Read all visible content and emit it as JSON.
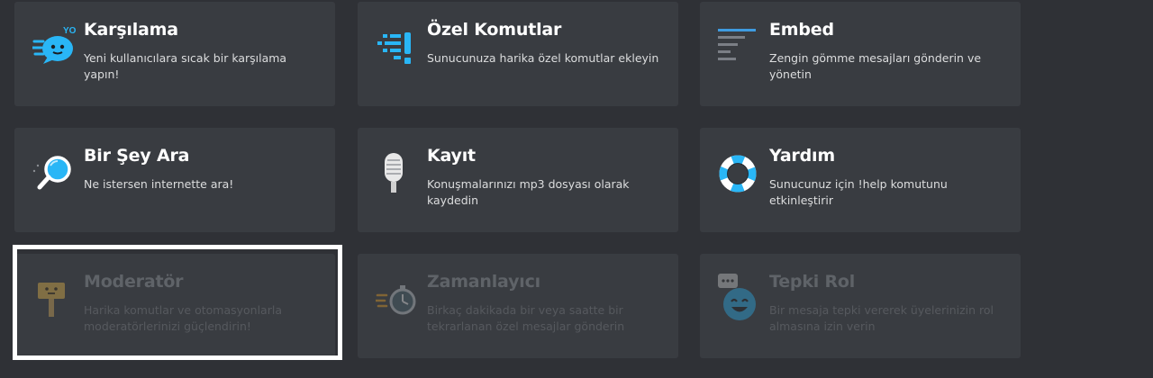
{
  "cards": [
    {
      "title": "Karşılama",
      "desc": "Yeni kullanıcılara sıcak bir karşılama yapın!",
      "icon": "welcome-yo-icon"
    },
    {
      "title": "Özel Komutlar",
      "desc": "Sunucunuza harika özel komutlar ekleyin",
      "icon": "custom-commands-icon"
    },
    {
      "title": "Embed",
      "desc": "Zengin gömme mesajları gönderin ve yönetin",
      "icon": "embed-lines-icon"
    },
    {
      "title": "Bir Şey Ara",
      "desc": "Ne istersen internette ara!",
      "icon": "magnifier-icon"
    },
    {
      "title": "Kayıt",
      "desc": "Konuşmalarınızı mp3 dosyası olarak kaydedin",
      "icon": "microphone-icon"
    },
    {
      "title": "Yardım",
      "desc": "Sunucunuz için !help komutunu etkinleştirir",
      "icon": "lifebuoy-icon"
    },
    {
      "title": "Moderatör",
      "desc": "Harika komutlar ve otomasyonlarla moderatörlerinizi güçlendirin!",
      "icon": "ban-hammer-icon"
    },
    {
      "title": "Zamanlayıcı",
      "desc": "Birkaç dakikada bir veya saatte bir tekrarlanan özel mesajlar gönderin",
      "icon": "stopwatch-icon"
    },
    {
      "title": "Tepki Rol",
      "desc": "Bir mesaja tepki vererek üyelerinizin rol almasına izin verin",
      "icon": "smiley-reaction-icon"
    }
  ],
  "colors": {
    "accent": "#29b6f6",
    "background": "#2f3136",
    "card": "#393c41",
    "highlight": "#ffffff"
  }
}
